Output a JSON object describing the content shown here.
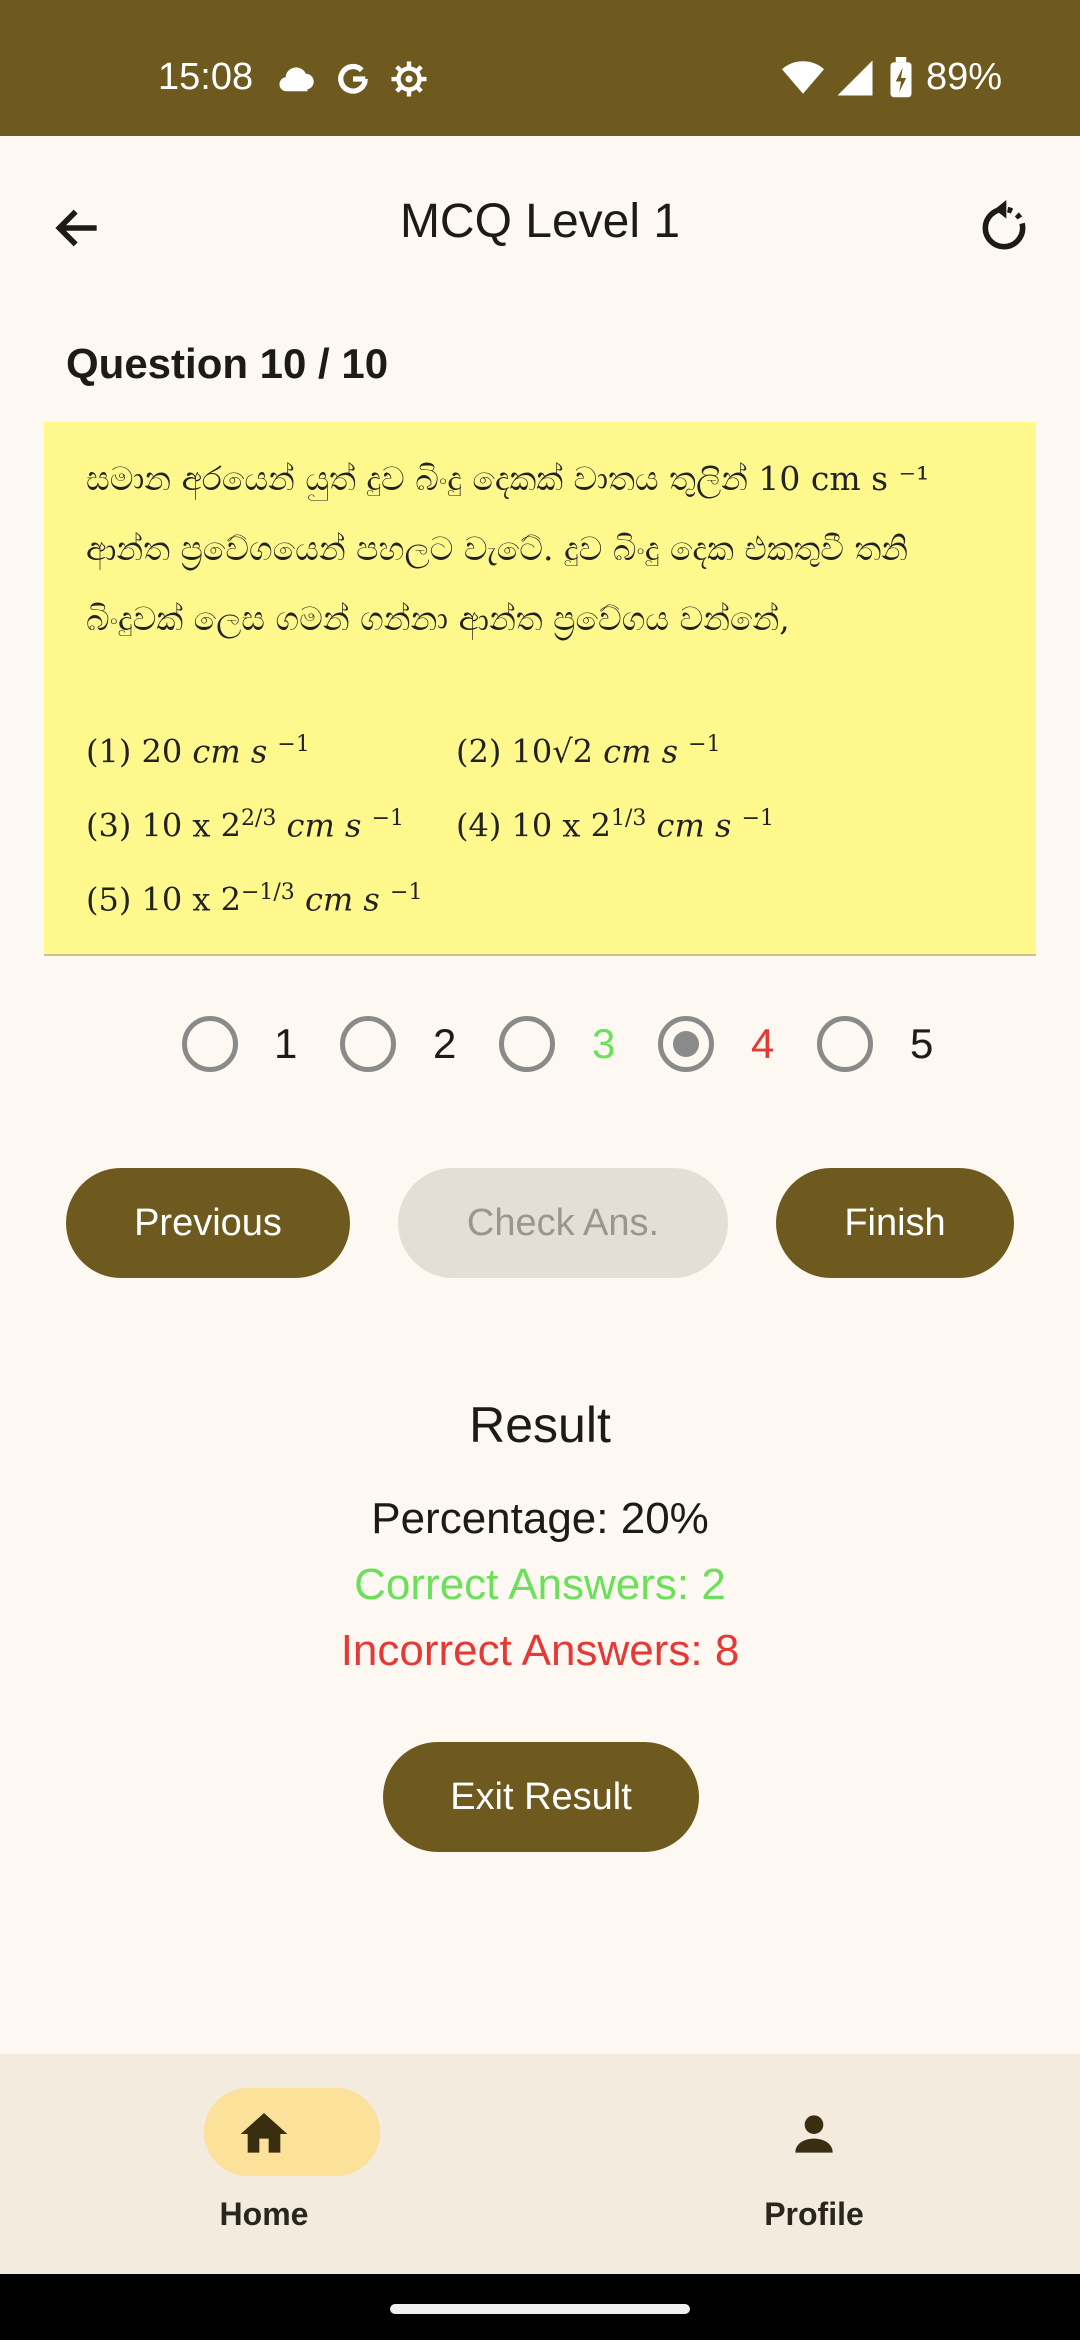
{
  "status_bar": {
    "time": "15:08",
    "battery": "89%"
  },
  "app_bar": {
    "title": "MCQ Level 1"
  },
  "question": {
    "label": "Question 10 / 10",
    "text": "සමාන අරයෙන් යුත් දුව බිංදු දෙකක් වාතය තුලින් 10 cm s ⁻¹ ආන්ත ප්‍රවේගයෙන් පහලට වැටේ. දුව බිංදු දෙක එකතුවී තනි බිංදුවක් ලෙස ගමන් ගන්නා ආන්ත ප්‍රවේගය වන්නේ,",
    "options": [
      {
        "num": "(1)",
        "value": "20",
        "unit": "cm s",
        "exp": "−1",
        "pow": ""
      },
      {
        "num": "(2)",
        "value": "10√2",
        "unit": "cm s",
        "exp": "−1",
        "pow": ""
      },
      {
        "num": "(3)",
        "value": "10 x 2",
        "unit": "cm s",
        "exp": "−1",
        "pow": "2/3"
      },
      {
        "num": "(4)",
        "value": "10 x 2",
        "unit": "cm s",
        "exp": "−1",
        "pow": "1/3"
      },
      {
        "num": "(5)",
        "value": "10 x 2",
        "unit": "cm s",
        "exp": "−1",
        "pow": "−1/3"
      }
    ]
  },
  "answer_choices": [
    {
      "label": "1",
      "selected": false,
      "color": "#1d1b16"
    },
    {
      "label": "2",
      "selected": false,
      "color": "#1d1b16"
    },
    {
      "label": "3",
      "selected": false,
      "color": "#6BE05A"
    },
    {
      "label": "4",
      "selected": true,
      "color": "#E53935"
    },
    {
      "label": "5",
      "selected": false,
      "color": "#1d1b16"
    }
  ],
  "buttons": {
    "previous": "Previous",
    "check": "Check Ans.",
    "finish": "Finish",
    "exit": "Exit Result"
  },
  "result": {
    "title": "Result",
    "percentage": "Percentage: 20%",
    "correct": "Correct Answers: 2",
    "incorrect": "Incorrect Answers: 8",
    "correct_color": "#6BE05A",
    "incorrect_color": "#E53935"
  },
  "bottom_nav": {
    "home": "Home",
    "profile": "Profile"
  },
  "colors": {
    "primary": "#6E5A1E",
    "card": "#FFF88D",
    "background": "#FDF8F1"
  }
}
